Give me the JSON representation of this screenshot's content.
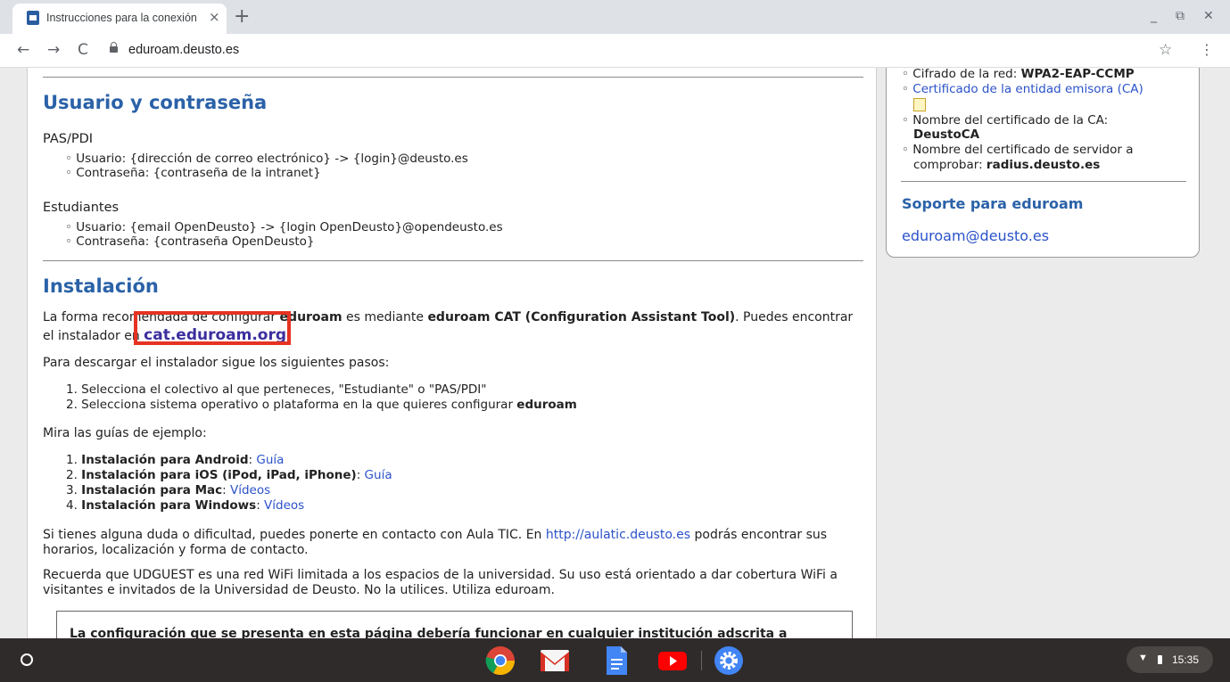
{
  "browser": {
    "tab_title": "Instrucciones para la conexión a",
    "tab_close": "×",
    "new_tab": "+",
    "url": "eduroam.deusto.es",
    "nav": {
      "back": "←",
      "forward": "→",
      "reload": "C"
    },
    "win": {
      "minimize": "_",
      "restore": "⧉",
      "close": "✕"
    },
    "star": "☆",
    "menu": "⋮"
  },
  "main": {
    "section1_title": "Usuario y contraseña",
    "pas_heading": "PAS/PDI",
    "pas_items": [
      "Usuario: {dirección de correo electrónico} -> {login}@deusto.es",
      "Contraseña: {contraseña de la intranet}"
    ],
    "est_heading": "Estudiantes",
    "est_items": [
      "Usuario: {email OpenDeusto} -> {login OpenDeusto}@opendeusto.es",
      "Contraseña: {contraseña OpenDeusto}"
    ],
    "section2_title": "Instalación",
    "intro_line1_a": "La forma recomendada de configurar ",
    "intro_line1_b": "eduroam",
    "intro_line1_c": " es mediante ",
    "intro_line1_d": "eduroam CAT (Configuration Assistant Tool)",
    "intro_line1_e": ". Puedes encontrar",
    "intro_line2_a": "el instalador en ",
    "cat_link": "cat.eduroam.org",
    "intro_line2_c": ".",
    "steps_intro": "Para descargar el instalador sigue los siguientes pasos:",
    "step1": "Selecciona el colectivo al que perteneces, \"Estudiante\" o \"PAS/PDI\"",
    "step2_a": "Selecciona sistema operativo o plataforma en la que quieres configurar ",
    "step2_b": "eduroam",
    "guides_intro": "Mira las guías de ejemplo:",
    "guides": [
      {
        "label": "Instalación para Android",
        "link": "Guía"
      },
      {
        "label": "Instalación para iOS (iPod, iPad, iPhone)",
        "link": "Guía"
      },
      {
        "label": "Instalación para Mac",
        "link": "Vídeos"
      },
      {
        "label": "Instalación para Windows",
        "link": "Vídeos"
      }
    ],
    "help_a": "Si tienes alguna duda o dificultad, puedes ponerte en contacto con Aula TIC. En ",
    "help_link": "http://aulatic.deusto.es",
    "help_b": " podrás encontrar sus",
    "help_line2": "horarios, localización y forma de contacto.",
    "guest_line1": "Recuerda que UDGUEST es una red WiFi limitada a los espacios de la universidad. Su uso está orientado a dar cobertura WiFi a",
    "guest_line2": "visitantes e invitados de la Universidad de Deusto. No la utilices. Utiliza eduroam.",
    "note": "La configuración que se presenta en esta página debería funcionar en cualquier institución adscrita a"
  },
  "sidebar": {
    "cipher_label": "Cifrado de la red: ",
    "cipher_value": "WPA2-EAP-CCMP",
    "ca_link": "Certificado de la entidad emisora (CA)",
    "ca_name_label": "Nombre del certificado de la CA:",
    "ca_name_value": "DeustoCA",
    "server_label_1": "Nombre del certificado de servidor a",
    "server_label_2": "comprobar: ",
    "server_value": "radius.deusto.es",
    "support_title": "Soporte para eduroam",
    "support_email": "eduroam@deusto.es"
  },
  "taskbar": {
    "time": "15:35",
    "apps": [
      "chrome-icon",
      "gmail-icon",
      "docs-icon",
      "youtube-icon",
      "settings-icon"
    ]
  },
  "colors": {
    "heading": "#2b62a8",
    "link": "#2b52c9",
    "highlight": "#e53323"
  }
}
